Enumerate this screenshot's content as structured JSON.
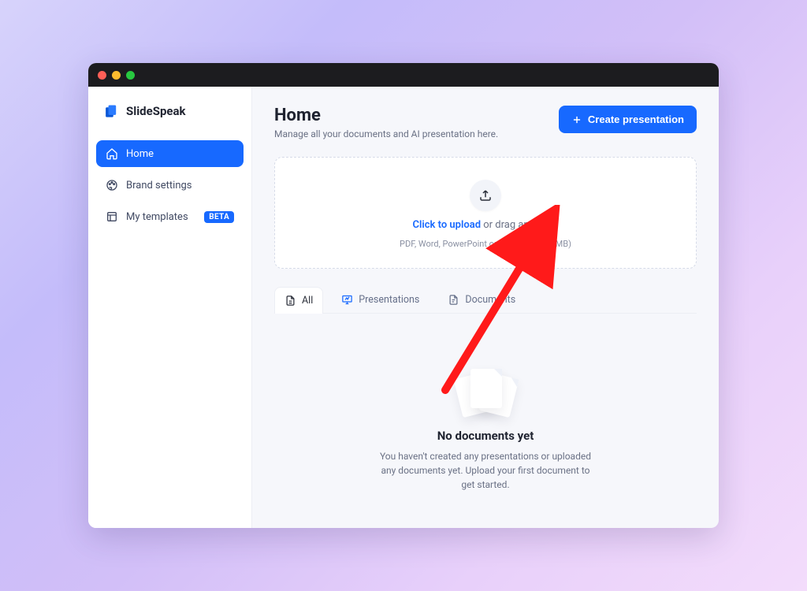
{
  "brand": {
    "name": "SlideSpeak"
  },
  "sidebar": {
    "items": [
      {
        "label": "Home"
      },
      {
        "label": "Brand settings"
      },
      {
        "label": "My templates",
        "badge": "BETA"
      }
    ]
  },
  "header": {
    "title": "Home",
    "subtitle": "Manage all your documents and AI presentation here.",
    "create_label": "Create presentation"
  },
  "dropzone": {
    "cta": "Click to upload",
    "rest": " or drag and drop",
    "hint": "PDF, Word, PowerPoint or Excel (max 50 MB)"
  },
  "tabs": {
    "all": "All",
    "presentations": "Presentations",
    "documents": "Documents"
  },
  "empty": {
    "title": "No documents yet",
    "subtitle": "You haven't created any presentations or uploaded any documents yet. Upload your first document to get started."
  }
}
